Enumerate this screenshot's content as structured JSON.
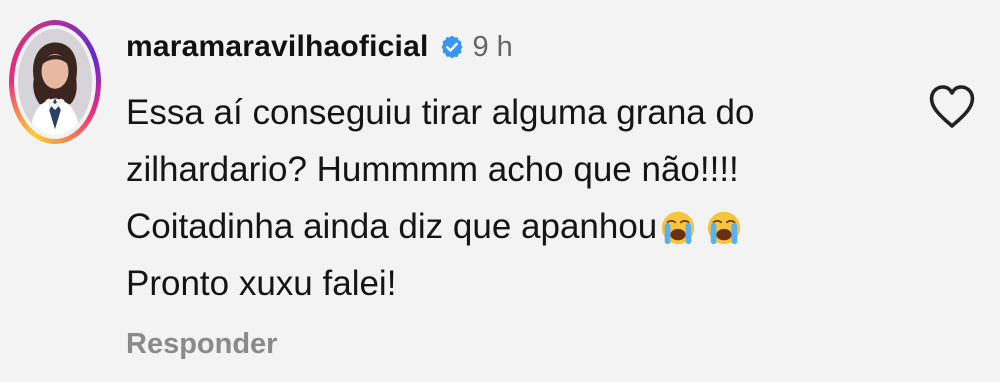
{
  "comment": {
    "username": "maramaravilhaoficial",
    "verified": true,
    "timestamp": "9 h",
    "lines": [
      "Essa aí conseguiu tirar alguma grana do",
      "zilhardario? Hummmm acho que não!!!!",
      "Coitadinha ainda diz que apanhou",
      "Pronto xuxu falei!"
    ],
    "line3_emojis": [
      "loudly-crying-face-emoji",
      "loudly-crying-face-emoji"
    ],
    "reply_label": "Responder"
  },
  "icons": {
    "verified": "verified-badge-icon",
    "like": "heart-outline-icon"
  },
  "colors": {
    "background": "#f3f3f3",
    "verified_blue": "#3797f0",
    "muted_text": "#8a8a8a"
  }
}
